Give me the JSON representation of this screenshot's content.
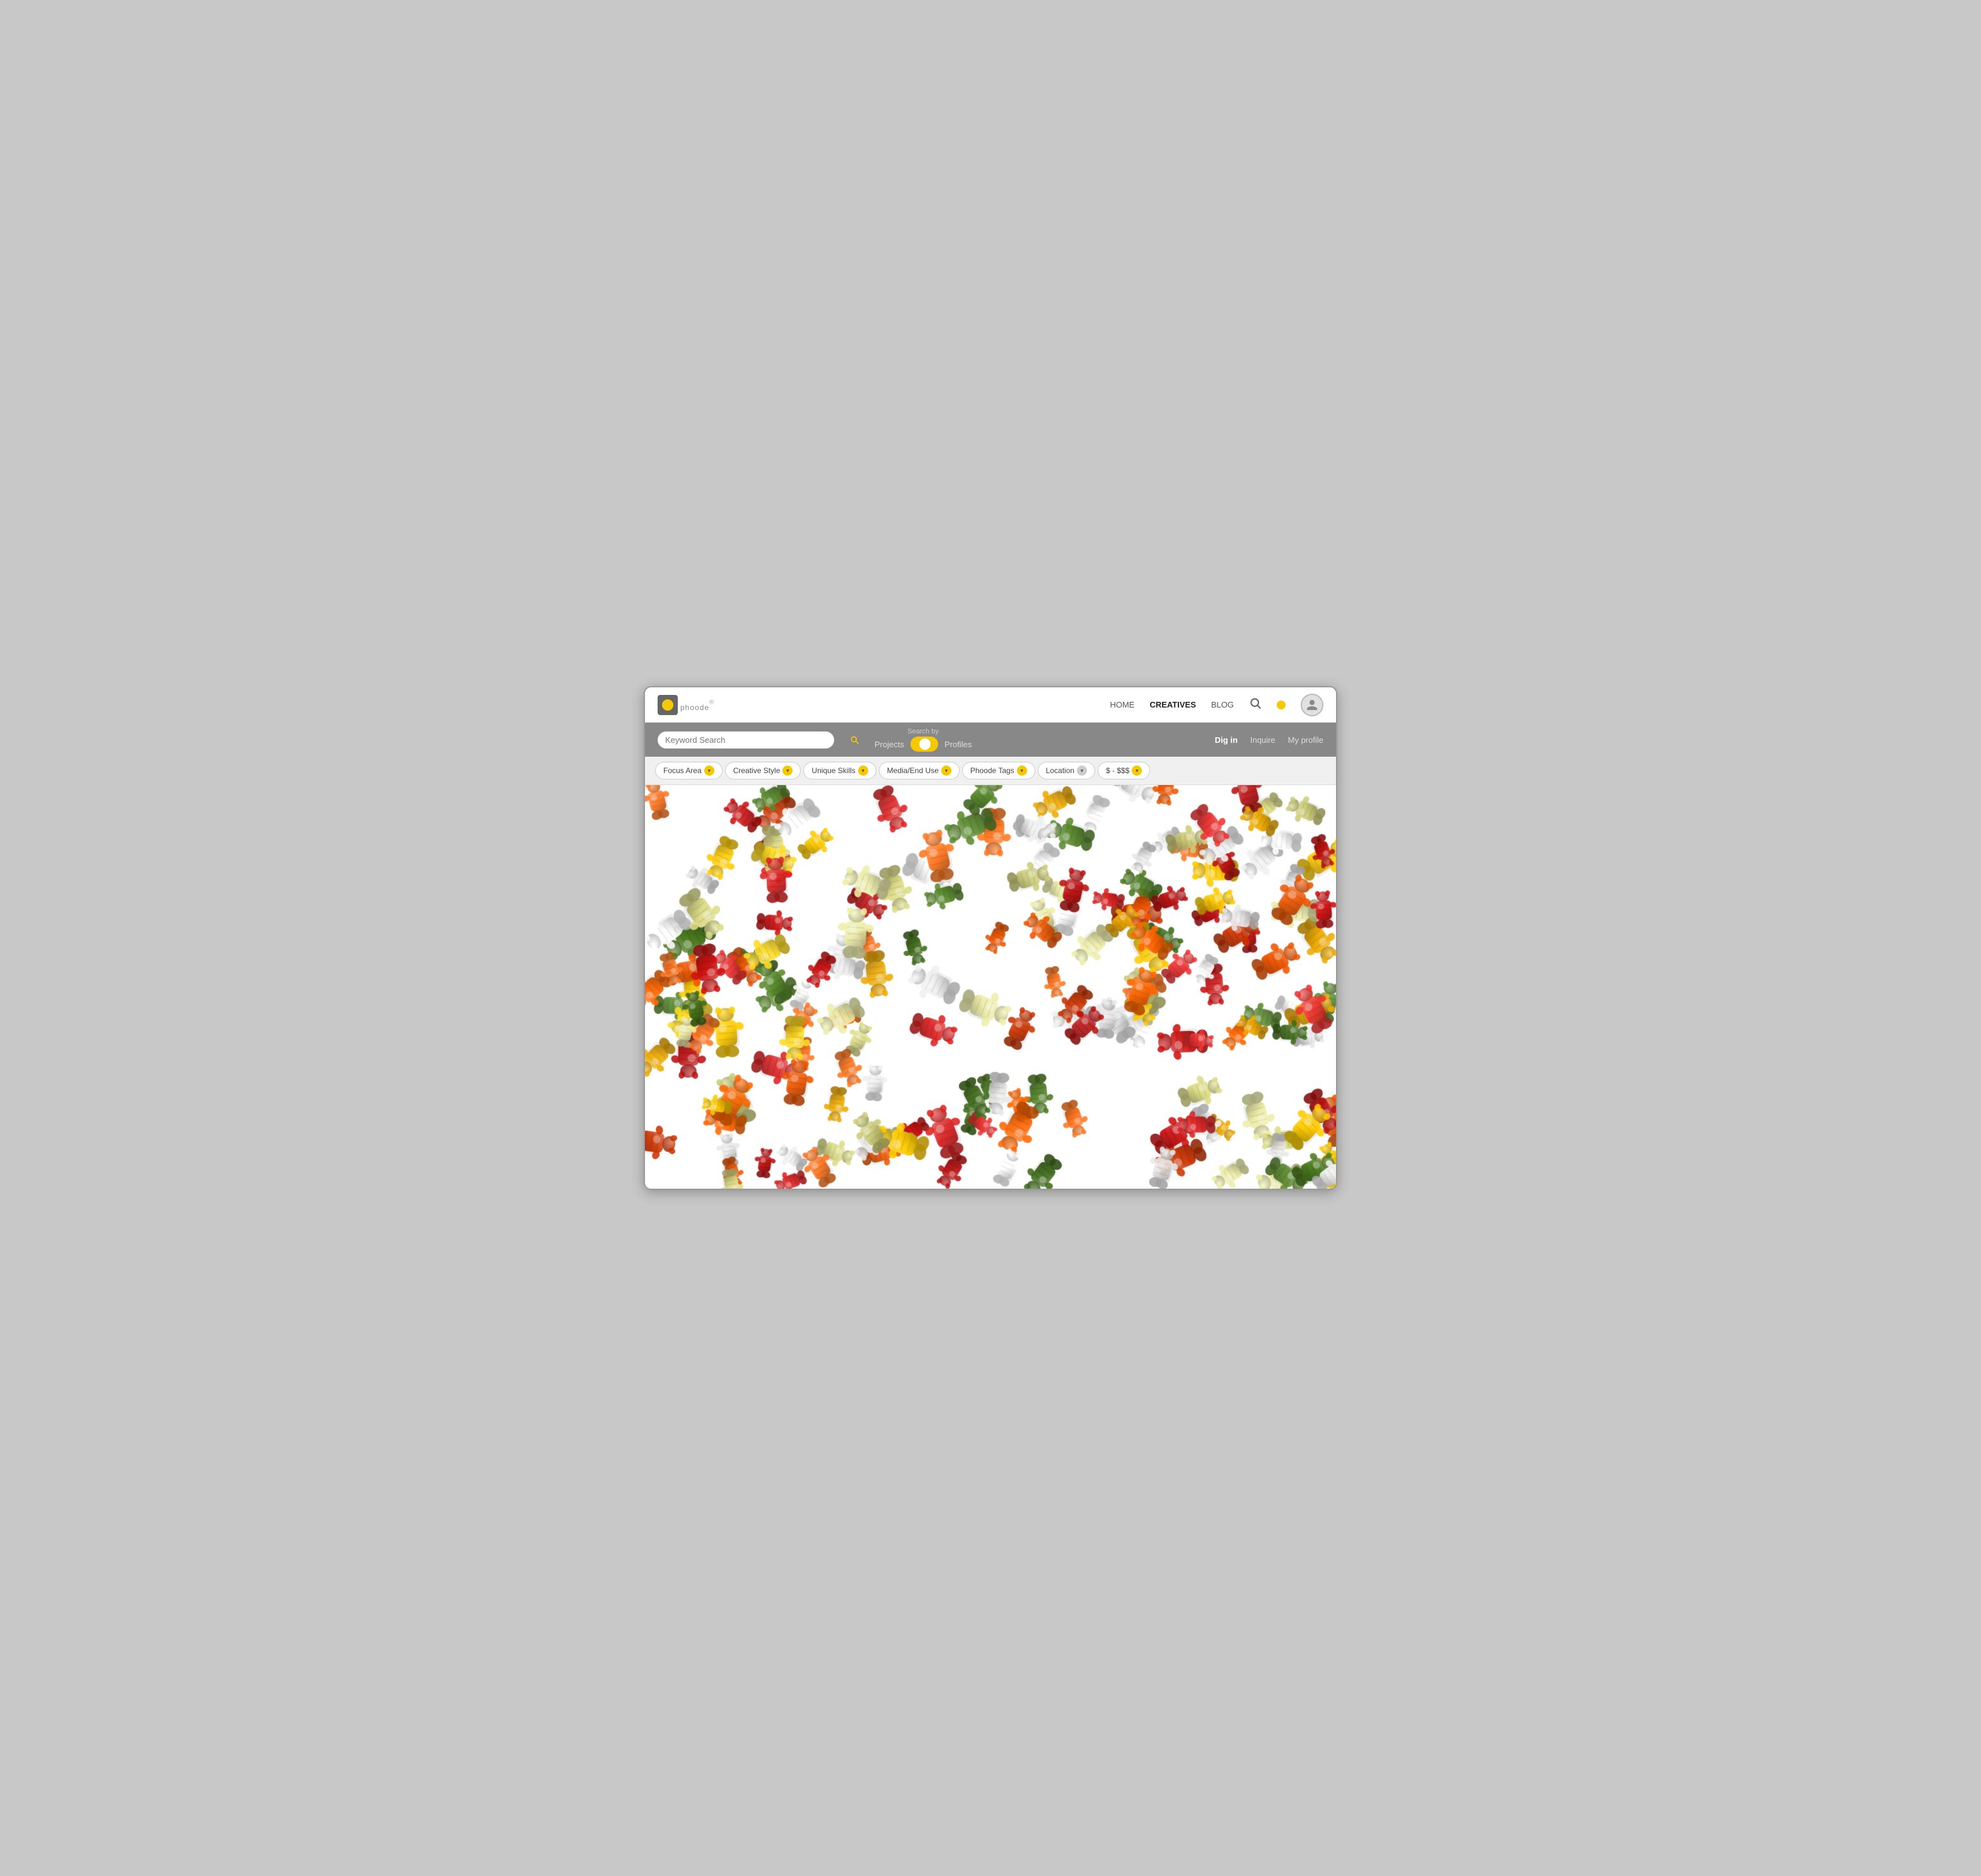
{
  "logo": {
    "text": "phoode",
    "registered": "®"
  },
  "nav": {
    "home_label": "HOME",
    "creatives_label": "CREATIVES",
    "blog_label": "BLOG"
  },
  "search": {
    "placeholder": "Keyword Search",
    "search_by_label": "Search by",
    "projects_label": "Projects",
    "profiles_label": "Profiles",
    "toggle_state": "projects"
  },
  "actions": {
    "dig_in": "Dig in",
    "inquire": "Inquire",
    "my_profile": "My profile"
  },
  "filters": [
    {
      "id": "focus-area",
      "label": "Focus Area",
      "chevron_color": "yellow"
    },
    {
      "id": "creative-style",
      "label": "Creative Style",
      "chevron_color": "yellow"
    },
    {
      "id": "unique-skills",
      "label": "Unique Skills",
      "chevron_color": "yellow"
    },
    {
      "id": "media-end-use",
      "label": "Media/End Use",
      "chevron_color": "yellow"
    },
    {
      "id": "phoode-tags",
      "label": "Phoode Tags",
      "chevron_color": "yellow"
    },
    {
      "id": "location",
      "label": "Location",
      "chevron_color": "gray"
    },
    {
      "id": "price",
      "label": "$ - $$$",
      "chevron_color": "yellow"
    }
  ],
  "colors": {
    "accent": "#f5c800",
    "nav_bg": "#888888",
    "filter_bg": "#f0f0f0"
  }
}
